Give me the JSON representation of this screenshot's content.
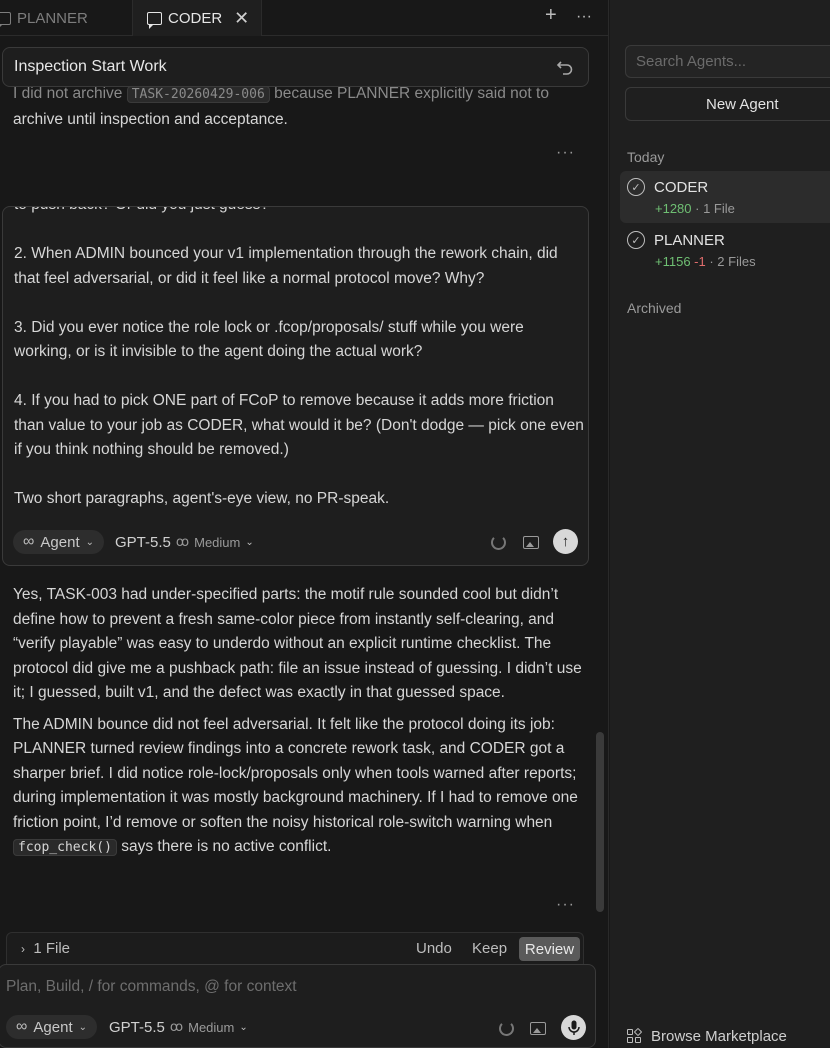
{
  "tabs": [
    {
      "label": "PLANNER"
    },
    {
      "label": "CODER"
    }
  ],
  "tab_actions": {
    "new": "+",
    "more": "···"
  },
  "chat_title": "Inspection Start Work",
  "prev_message": {
    "line1_a": "I did not archive ",
    "line1_code": "TASK-20260429-006",
    "line1_b": " because PLANNER explicitly said not to",
    "line2": "archive until inspection and acceptance."
  },
  "more_dots": "···",
  "user_message": {
    "cut_line": "to push back? Or did you just guess?",
    "q2": "2. When ADMIN bounced your v1 implementation through the rework chain, did that feel adversarial, or did it feel like a normal protocol move? Why?",
    "q3": "3. Did you ever notice the role lock or .fcop/proposals/ stuff while you were working, or is it invisible to the agent doing the actual work?",
    "q4": "4. If you had to pick ONE part of FCoP to remove because it adds more friction than value to your job as CODER, what would it be? (Don't dodge — pick one even if you think nothing should be removed.)",
    "closing": "Two short paragraphs, agent's-eye view, no PR-speak."
  },
  "mode": {
    "label": "Agent",
    "model": "GPT-5.5",
    "effort": "Medium"
  },
  "response": {
    "p1": "Yes, TASK-003 had under-specified parts: the motif rule sounded cool but didn’t define how to prevent a fresh same-color piece from instantly self-clearing, and “verify playable” was easy to underdo without an explicit runtime checklist. The protocol did give me a pushback path: file an issue instead of guessing. I didn’t use it; I guessed, built v1, and the defect was exactly in that guessed space.",
    "p2_a": "The ADMIN bounce did not feel adversarial. It felt like the protocol doing its job: PLANNER turned review findings into a concrete rework task, and CODER got a sharper brief. I did notice role-lock/proposals only when tools warned after reports; during implementation it was mostly background machinery. If I had to remove one friction point, I’d remove or soften the noisy historical role-switch warning when ",
    "p2_code": "fcop_check()",
    "p2_b": " says there is no active conflict."
  },
  "filebar": {
    "label": "1 File",
    "undo": "Undo",
    "keep": "Keep",
    "review": "Review"
  },
  "composer": {
    "placeholder": "Plan, Build, / for commands, @ for context"
  },
  "sidebar": {
    "search_placeholder": "Search Agents...",
    "new_agent": "New Agent",
    "today_label": "Today",
    "agents": [
      {
        "name": "CODER",
        "added": "+1280",
        "removed": "",
        "files": "· 1 File"
      },
      {
        "name": "PLANNER",
        "added": "+1156",
        "removed": "-1",
        "files": "· 2 Files"
      }
    ],
    "archived_label": "Archived",
    "marketplace": "Browse Marketplace"
  }
}
